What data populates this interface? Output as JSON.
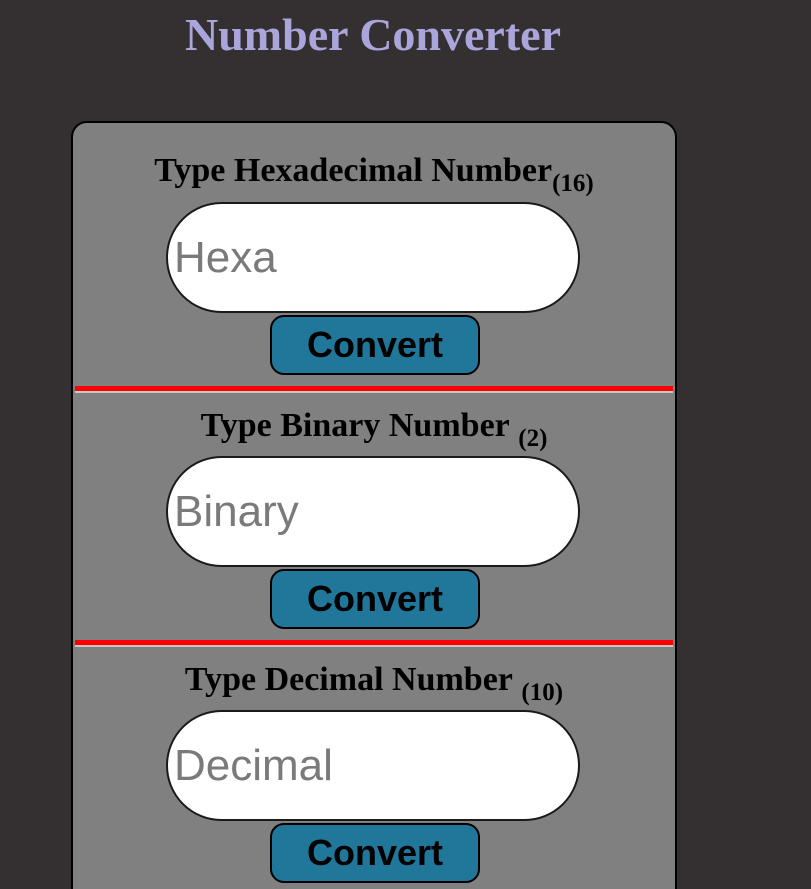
{
  "page": {
    "title": "Number Converter"
  },
  "sections": [
    {
      "label": "Type Hexadecimal Number",
      "base": "(16)",
      "input_placeholder": "Hexa",
      "input_value": "",
      "button_label": "Convert"
    },
    {
      "label": "Type Binary Number",
      "base": "(2)",
      "input_placeholder": "Binary",
      "input_value": "",
      "button_label": "Convert"
    },
    {
      "label": "Type Decimal Number",
      "base": "(10)",
      "input_placeholder": "Decimal",
      "input_value": "",
      "button_label": "Convert"
    }
  ],
  "colors": {
    "background": "#343031",
    "title": "#aaa6dc",
    "card": "#808080",
    "divider": "#ff0000",
    "button": "#21779a"
  }
}
